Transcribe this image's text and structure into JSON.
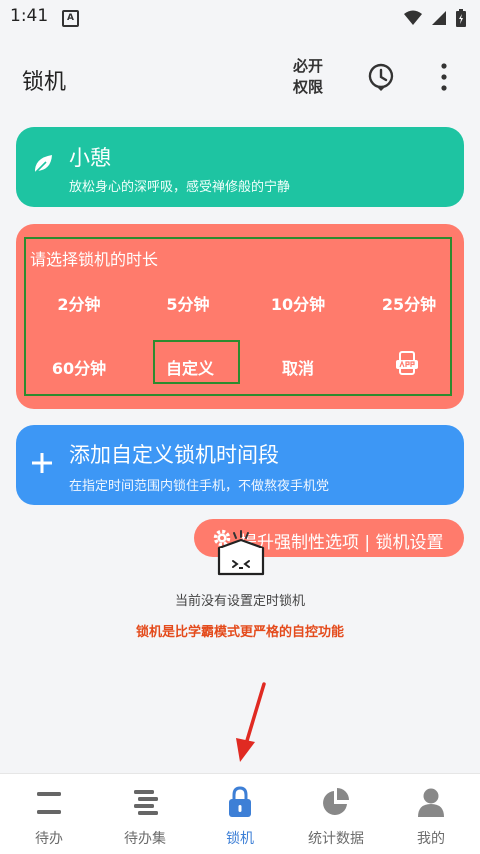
{
  "status_bar": {
    "time": "1:41",
    "badge": "A"
  },
  "app_bar": {
    "title": "锁机",
    "permission_line1": "必开",
    "permission_line2": "权限",
    "icons": [
      "clock-icon",
      "more-vert-icon"
    ]
  },
  "rest_card": {
    "title": "小憩",
    "subtitle": "放松身心的深呼吸，感受禅修般的宁静",
    "color": "#1ec4a2"
  },
  "lock_card": {
    "heading": "请选择锁机的时长",
    "options": [
      "2分钟",
      "5分钟",
      "10分钟",
      "25分钟",
      "60分钟",
      "自定义",
      "取消"
    ],
    "color": "#ff7b6c"
  },
  "add_card": {
    "title": "添加自定义锁机时间段",
    "subtitle": "在指定时间范围内锁住手机，不做熬夜手机党",
    "color": "#3d97f5"
  },
  "boost": {
    "label": "提升强制性选项 | 锁机设置"
  },
  "empty_state": {
    "text": "当前没有设置定时锁机",
    "note": "锁机是比学霸模式更严格的自控功能",
    "note_color": "#e44b1c"
  },
  "nav": {
    "items": [
      {
        "label": "待办",
        "icon": "todo-icon"
      },
      {
        "label": "待办集",
        "icon": "todo-set-icon"
      },
      {
        "label": "锁机",
        "icon": "lock-icon"
      },
      {
        "label": "统计数据",
        "icon": "pie-chart-icon"
      },
      {
        "label": "我的",
        "icon": "person-icon"
      }
    ],
    "active_index": 2,
    "active_color": "#3d7fd6"
  }
}
